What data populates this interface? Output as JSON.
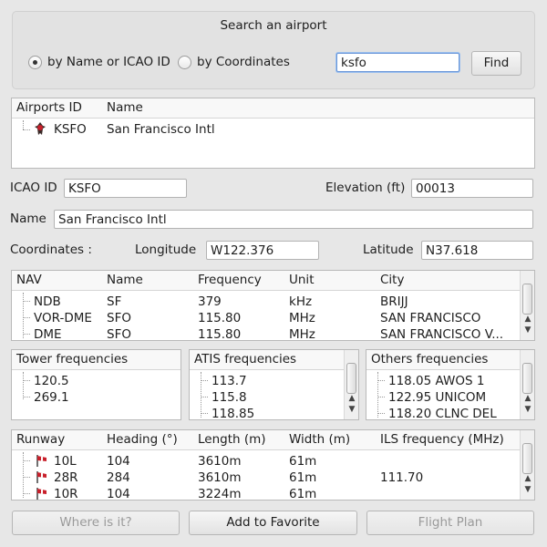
{
  "search": {
    "title": "Search an airport",
    "radio_name_label": "by Name or ICAO ID",
    "radio_coords_label": "by Coordinates",
    "query": "ksfo",
    "find_label": "Find"
  },
  "airports": {
    "col_id": "Airports ID",
    "col_name": "Name",
    "rows": [
      {
        "id": "KSFO",
        "name": "San Francisco Intl"
      }
    ]
  },
  "details": {
    "icao_label": "ICAO ID",
    "icao_value": "KSFO",
    "elevation_label": "Elevation (ft)",
    "elevation_value": "00013",
    "name_label": "Name",
    "name_value": "San Francisco Intl",
    "coords_label": "Coordinates :",
    "longitude_label": "Longitude",
    "longitude_value": "W122.376",
    "latitude_label": "Latitude",
    "latitude_value": "N37.618"
  },
  "nav": {
    "headers": [
      "NAV",
      "Name",
      "Frequency",
      "Unit",
      "City"
    ],
    "rows": [
      [
        "NDB",
        "SF",
        "379",
        "kHz",
        "BRIJJ"
      ],
      [
        "VOR-DME",
        "SFO",
        "115.80",
        "MHz",
        "SAN FRANCISCO"
      ],
      [
        "DME",
        "SFO",
        "115.80",
        "MHz",
        "SAN FRANCISCO V..."
      ]
    ]
  },
  "tower": {
    "title": "Tower frequencies",
    "items": [
      "120.5",
      "269.1"
    ]
  },
  "atis": {
    "title": "ATIS frequencies",
    "items": [
      "113.7",
      "115.8",
      "118.85"
    ]
  },
  "others": {
    "title": "Others frequencies",
    "items": [
      "118.05 AWOS 1",
      "122.95 UNICOM",
      "118.20 CLNC DEL"
    ]
  },
  "runways": {
    "headers": [
      "Runway",
      "Heading (°)",
      "Length (m)",
      "Width (m)",
      "ILS frequency (MHz)"
    ],
    "rows": [
      [
        "10L",
        "104",
        "3610m",
        "61m",
        ""
      ],
      [
        "28R",
        "284",
        "3610m",
        "61m",
        "111.70"
      ],
      [
        "10R",
        "104",
        "3224m",
        "61m",
        ""
      ]
    ]
  },
  "buttons": {
    "where": "Where is it?",
    "favorite": "Add to Favorite",
    "flight_plan": "Flight Plan"
  },
  "colors": {
    "flag_red": "#c8202b",
    "pin_dark": "#3a2a28"
  }
}
